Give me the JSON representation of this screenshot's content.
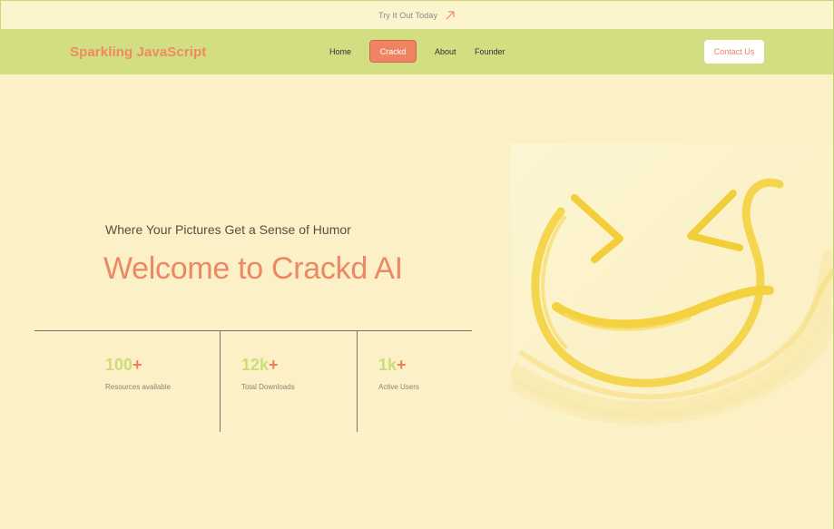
{
  "announcement": {
    "text": "Try It Out Today",
    "icon": "arrow-up-right-icon"
  },
  "navbar": {
    "brand": "Sparkling JavaScript",
    "links": [
      "Home",
      "Crackd",
      "About",
      "Founder"
    ],
    "active_link": "Crackd",
    "contact_label": "Contact Us"
  },
  "hero": {
    "tagline": "Where Your Pictures Get a Sense of Humor",
    "title": "Welcome to Crackd AI",
    "illustration_icon": "laughing-face-brushstroke"
  },
  "stats": [
    {
      "value": "100",
      "suffix": "+",
      "label": "Resources available"
    },
    {
      "value": "12k",
      "suffix": "+",
      "label": "Total Downloads"
    },
    {
      "value": "1k",
      "suffix": "+",
      "label": "Active Users"
    }
  ],
  "colors": {
    "background": "#fcf1c6",
    "navbar": "#d3de83",
    "accent_orange": "#ef8b5b",
    "accent_green": "#cddc79",
    "illustration_yellow": "#f3d34a"
  }
}
